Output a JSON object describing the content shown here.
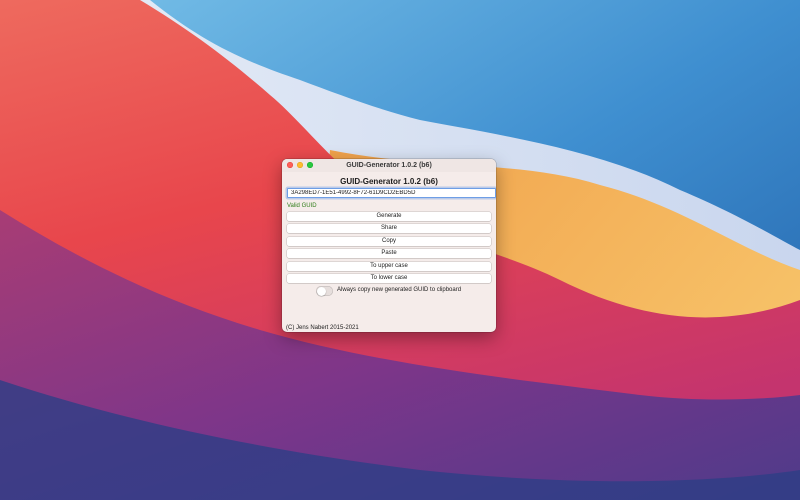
{
  "window": {
    "title": "GUID-Generator 1.0.2 (b6)"
  },
  "app": {
    "heading": "GUID-Generator 1.0.2 (b6)",
    "guid_value": "3A298ED7-1E51-4992-8F72-61D9CD2EBD5D",
    "validation_text": "Valid GUID",
    "validation_color": "#2f7d19",
    "buttons": {
      "generate": "Generate",
      "share": "Share",
      "copy": "Copy",
      "paste": "Paste",
      "upper": "To upper case",
      "lower": "To lower case"
    },
    "auto_copy": {
      "label": "Always copy new generated GUID to clipboard",
      "enabled": false
    },
    "copyright": "(C) Jens Nabert 2015-2021"
  },
  "colors": {
    "close": "#fe5f57",
    "minimize": "#febc2e",
    "zoom": "#28c840",
    "focus_ring": "#6e9ee6"
  },
  "icons": [
    "close-icon",
    "minimize-icon",
    "zoom-icon"
  ]
}
